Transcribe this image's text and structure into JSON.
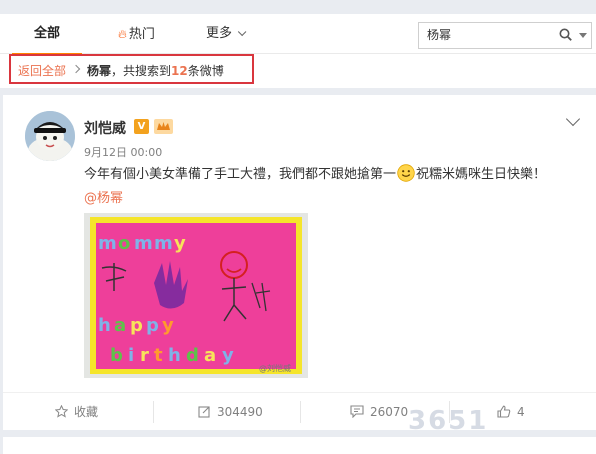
{
  "tabs": {
    "all": "全部",
    "hot": "热门",
    "more": "更多"
  },
  "search": {
    "value": "杨幂"
  },
  "breadcrumb": {
    "back": "返回全部",
    "keyword": "杨幂",
    "prefix": "，共搜索到",
    "count": "12",
    "suffix": "条微博"
  },
  "post": {
    "username": "刘恺威",
    "v_badge": "V",
    "time": "9月12日 00:00",
    "text_before": "今年有個小美女準備了手工大禮，我們都不跟她搶第一",
    "text_after": "祝糯米媽咪生日快樂！",
    "mention": "@杨幂",
    "image_watermark": "@刘恺威",
    "actions": {
      "favorite": "收藏",
      "forward": "304490",
      "comment": "26070",
      "like": "4"
    }
  },
  "site_watermark": "3651",
  "colors": {
    "accent_orange": "#ff8200",
    "link_orange": "#eb7350",
    "highlight_red": "#d9363e",
    "photo_pink": "#ee3f9a",
    "photo_border_yellow": "#f5e52a"
  }
}
